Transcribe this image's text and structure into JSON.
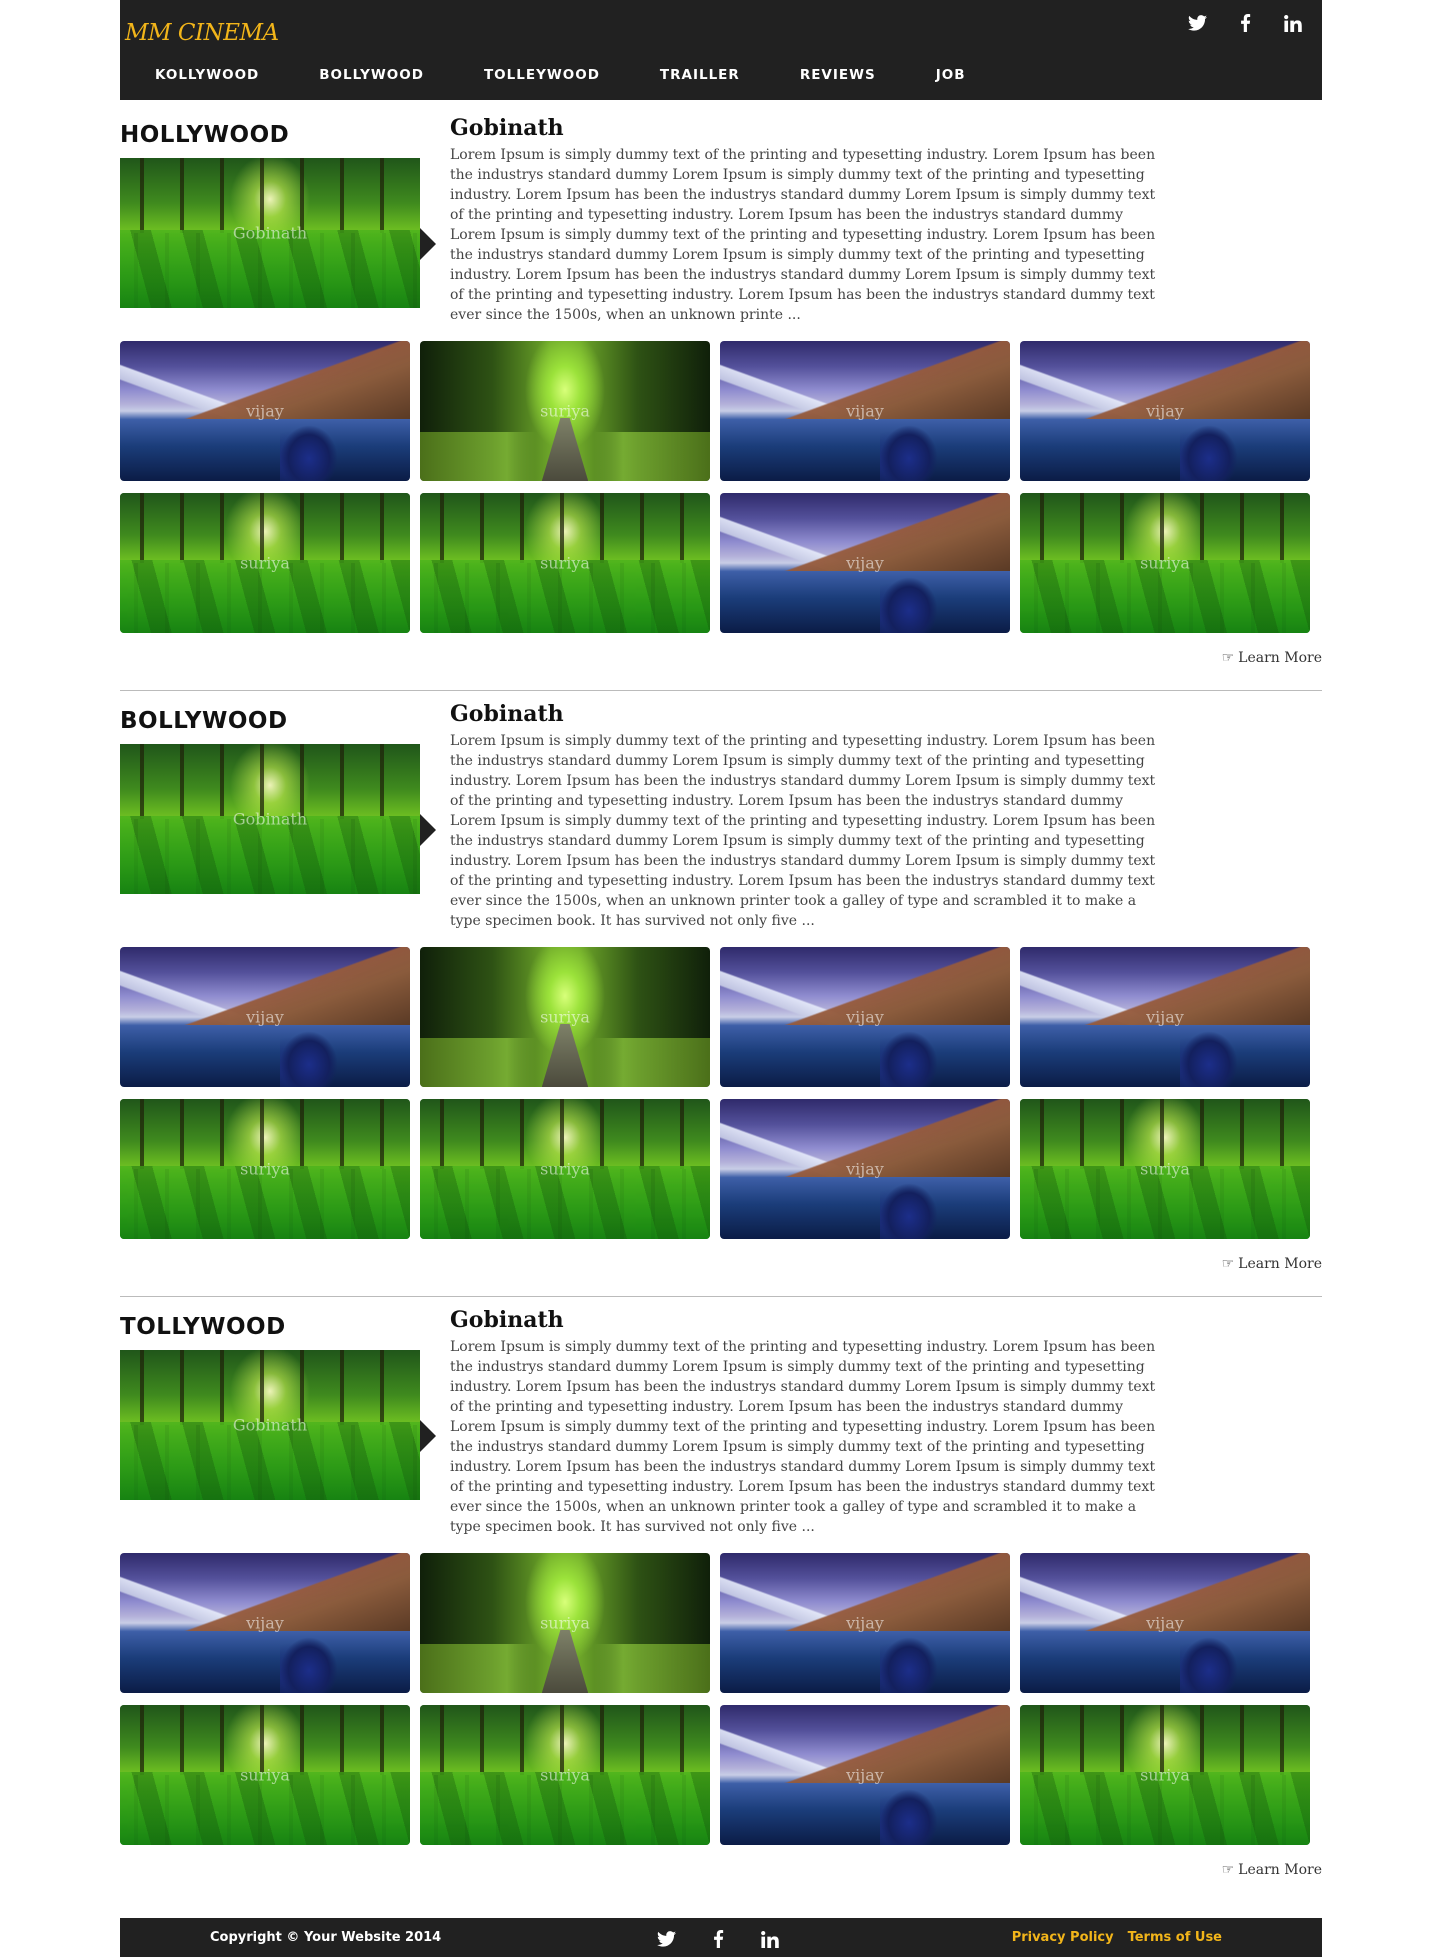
{
  "brand": {
    "logo": "MM CINEMA",
    "accent_color": "#f2b51a",
    "bar_color": "#212121"
  },
  "nav": {
    "items": [
      {
        "label": "KOLLYWOOD"
      },
      {
        "label": "BOLLYWOOD"
      },
      {
        "label": "TOLLEYWOOD"
      },
      {
        "label": "TRAILLER"
      },
      {
        "label": "REVIEWS"
      },
      {
        "label": "JOB"
      }
    ]
  },
  "social": {
    "icons": [
      "twitter-icon",
      "facebook-icon",
      "linkedin-icon"
    ]
  },
  "sections": [
    {
      "title": "HOLLYWOOD",
      "feature_caption": "Gobinath",
      "article_title": "Gobinath",
      "article_body": "Lorem Ipsum is simply dummy text of the printing and typesetting industry. Lorem Ipsum has been the industrys standard dummy Lorem Ipsum is simply dummy text of the printing and typesetting industry. Lorem Ipsum has been the industrys standard dummy Lorem Ipsum is simply dummy text of the printing and typesetting industry. Lorem Ipsum has been the industrys standard dummy Lorem Ipsum is simply dummy text of the printing and typesetting industry. Lorem Ipsum has been the industrys standard dummy Lorem Ipsum is simply dummy text of the printing and typesetting industry. Lorem Ipsum has been the industrys standard dummy Lorem Ipsum is simply dummy text of the printing and typesetting industry. Lorem Ipsum has been the industrys standard dummy text ever since the 1500s, when an unknown printe ...",
      "thumbs": [
        {
          "label": "vijay",
          "image": "lake"
        },
        {
          "label": "suriya",
          "image": "avenue"
        },
        {
          "label": "vijay",
          "image": "lake"
        },
        {
          "label": "vijay",
          "image": "lake"
        },
        {
          "label": "suriya",
          "image": "forest"
        },
        {
          "label": "suriya",
          "image": "forest"
        },
        {
          "label": "vijay",
          "image": "lake"
        },
        {
          "label": "suriya",
          "image": "forest"
        }
      ],
      "learn_more": "Learn More"
    },
    {
      "title": "BOLLYWOOD",
      "feature_caption": "Gobinath",
      "article_title": "Gobinath",
      "article_body": "Lorem Ipsum is simply dummy text of the printing and typesetting industry. Lorem Ipsum has been the industrys standard dummy Lorem Ipsum is simply dummy text of the printing and typesetting industry. Lorem Ipsum has been the industrys standard dummy Lorem Ipsum is simply dummy text of the printing and typesetting industry. Lorem Ipsum has been the industrys standard dummy Lorem Ipsum is simply dummy text of the printing and typesetting industry. Lorem Ipsum has been the industrys standard dummy Lorem Ipsum is simply dummy text of the printing and typesetting industry. Lorem Ipsum has been the industrys standard dummy Lorem Ipsum is simply dummy text of the printing and typesetting industry. Lorem Ipsum has been the industrys standard dummy text ever since the 1500s, when an unknown printer took a galley of type and scrambled it to make a type specimen book. It has survived not only five ...",
      "thumbs": [
        {
          "label": "vijay",
          "image": "lake"
        },
        {
          "label": "suriya",
          "image": "avenue"
        },
        {
          "label": "vijay",
          "image": "lake"
        },
        {
          "label": "vijay",
          "image": "lake"
        },
        {
          "label": "suriya",
          "image": "forest"
        },
        {
          "label": "suriya",
          "image": "forest"
        },
        {
          "label": "vijay",
          "image": "lake"
        },
        {
          "label": "suriya",
          "image": "forest"
        }
      ],
      "learn_more": "Learn More"
    },
    {
      "title": "TOLLYWOOD",
      "feature_caption": "Gobinath",
      "article_title": "Gobinath",
      "article_body": "Lorem Ipsum is simply dummy text of the printing and typesetting industry. Lorem Ipsum has been the industrys standard dummy Lorem Ipsum is simply dummy text of the printing and typesetting industry. Lorem Ipsum has been the industrys standard dummy Lorem Ipsum is simply dummy text of the printing and typesetting industry. Lorem Ipsum has been the industrys standard dummy Lorem Ipsum is simply dummy text of the printing and typesetting industry. Lorem Ipsum has been the industrys standard dummy Lorem Ipsum is simply dummy text of the printing and typesetting industry. Lorem Ipsum has been the industrys standard dummy Lorem Ipsum is simply dummy text of the printing and typesetting industry. Lorem Ipsum has been the industrys standard dummy text ever since the 1500s, when an unknown printer took a galley of type and scrambled it to make a type specimen book. It has survived not only five ...",
      "thumbs": [
        {
          "label": "vijay",
          "image": "lake"
        },
        {
          "label": "suriya",
          "image": "avenue"
        },
        {
          "label": "vijay",
          "image": "lake"
        },
        {
          "label": "vijay",
          "image": "lake"
        },
        {
          "label": "suriya",
          "image": "forest"
        },
        {
          "label": "suriya",
          "image": "forest"
        },
        {
          "label": "vijay",
          "image": "lake"
        },
        {
          "label": "suriya",
          "image": "forest"
        }
      ],
      "learn_more": "Learn More"
    }
  ],
  "footer": {
    "copyright": "Copyright © Your Website 2014",
    "links": [
      {
        "label": "Privacy Policy"
      },
      {
        "label": "Terms of Use"
      }
    ]
  }
}
